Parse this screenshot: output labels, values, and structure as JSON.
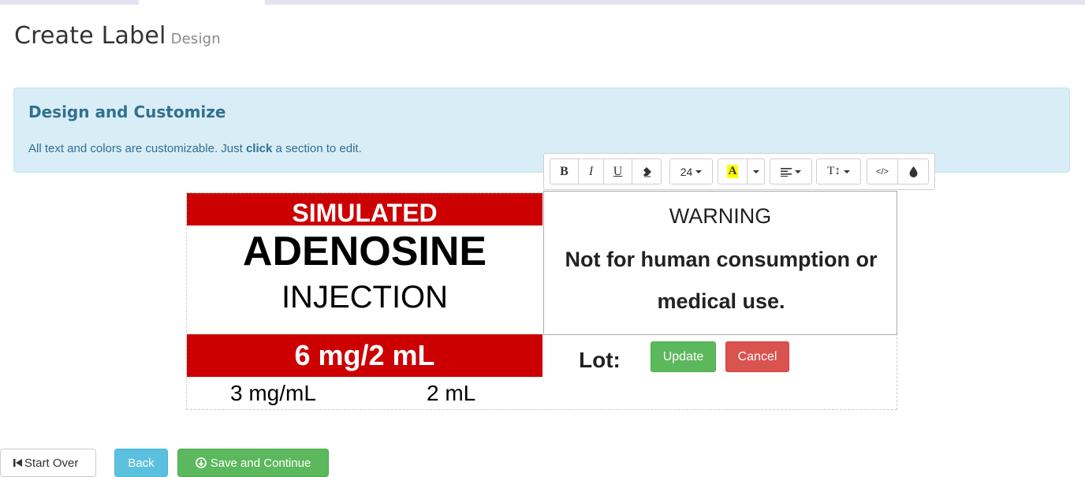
{
  "page": {
    "title": "Create Label",
    "subtitle": "Design"
  },
  "info": {
    "heading": "Design and Customize",
    "text_before": "All text and colors are customizable. Just ",
    "text_bold": "click",
    "text_after": " a section to edit."
  },
  "label": {
    "banner": "SIMULATED",
    "drug_name": "ADENOSINE",
    "dosage_form": "INJECTION",
    "strength": "6 mg/2 mL",
    "concentration": "3 mg/mL",
    "volume": "2 mL",
    "warning_title": "WARNING",
    "warning_text": "Not for human consumption or medical use.",
    "lot_label": "Lot:",
    "banner_color": "#cc0000"
  },
  "toolbar": {
    "bold": "B",
    "italic": "I",
    "underline": "U",
    "font_size": "24",
    "highlight": "A",
    "text_height": "T↕",
    "code_view": "</>"
  },
  "edit_buttons": {
    "update": "Update",
    "cancel": "Cancel"
  },
  "footer": {
    "start_over": "Start Over",
    "back": "Back",
    "save_continue": "Save and Continue"
  }
}
